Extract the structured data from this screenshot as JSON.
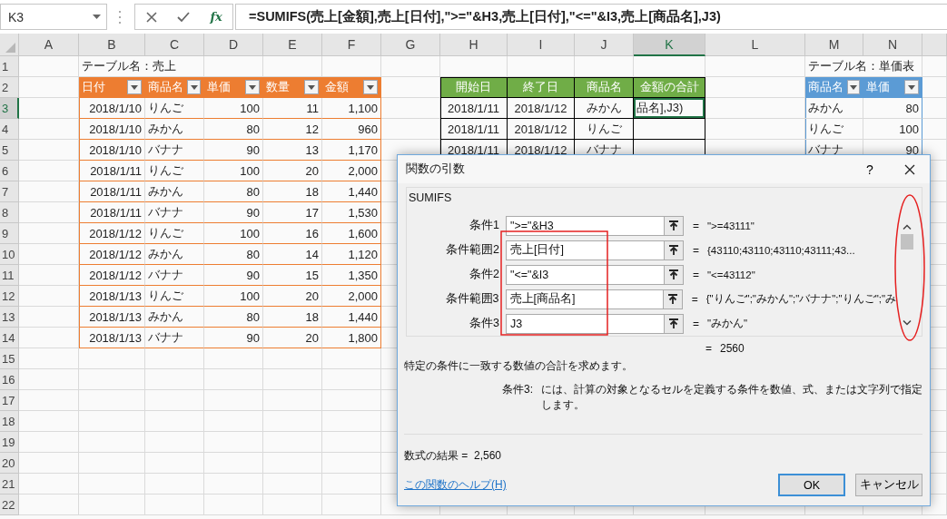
{
  "name_box": {
    "value": "K3"
  },
  "formula_bar": {
    "function_button": "fx",
    "formula": "=SUMIFS(売上[金額],売上[日付],\">=\"&H3,売上[日付],\"<=\"&I3,売上[商品名],J3)"
  },
  "sheet": {
    "columns": [
      {
        "label": "A",
        "selected": false
      },
      {
        "label": "B",
        "selected": false
      },
      {
        "label": "C",
        "selected": false
      },
      {
        "label": "D",
        "selected": false
      },
      {
        "label": "E",
        "selected": false
      },
      {
        "label": "F",
        "selected": false
      },
      {
        "label": "G",
        "selected": false
      },
      {
        "label": "H",
        "selected": false
      },
      {
        "label": "I",
        "selected": false
      },
      {
        "label": "J",
        "selected": false
      },
      {
        "label": "K",
        "selected": true
      },
      {
        "label": "L",
        "selected": false
      },
      {
        "label": "M",
        "selected": false
      },
      {
        "label": "N",
        "selected": false
      }
    ],
    "rows": [
      {
        "label": "1",
        "selected": false
      },
      {
        "label": "2",
        "selected": false
      },
      {
        "label": "3",
        "selected": true
      },
      {
        "label": "4",
        "selected": false
      },
      {
        "label": "5",
        "selected": false
      },
      {
        "label": "6",
        "selected": false
      },
      {
        "label": "7",
        "selected": false
      },
      {
        "label": "8",
        "selected": false
      },
      {
        "label": "9",
        "selected": false
      },
      {
        "label": "10",
        "selected": false
      },
      {
        "label": "11",
        "selected": false
      },
      {
        "label": "12",
        "selected": false
      },
      {
        "label": "13",
        "selected": false
      },
      {
        "label": "14",
        "selected": false
      },
      {
        "label": "15",
        "selected": false
      },
      {
        "label": "16",
        "selected": false
      },
      {
        "label": "17",
        "selected": false
      },
      {
        "label": "18",
        "selected": false
      },
      {
        "label": "19",
        "selected": false
      },
      {
        "label": "20",
        "selected": false
      },
      {
        "label": "21",
        "selected": false
      },
      {
        "label": "22",
        "selected": false
      }
    ]
  },
  "sales_table": {
    "caption": "テーブル名：売上",
    "filter_buttons": true,
    "columns": [
      "日付",
      "商品名",
      "単価",
      "数量",
      "金額"
    ],
    "rows": [
      [
        "2018/1/10",
        "りんご",
        "100",
        "11",
        "1,100"
      ],
      [
        "2018/1/10",
        "みかん",
        "80",
        "12",
        "960"
      ],
      [
        "2018/1/10",
        "バナナ",
        "90",
        "13",
        "1,170"
      ],
      [
        "2018/1/11",
        "りんご",
        "100",
        "20",
        "2,000"
      ],
      [
        "2018/1/11",
        "みかん",
        "80",
        "18",
        "1,440"
      ],
      [
        "2018/1/11",
        "バナナ",
        "90",
        "17",
        "1,530"
      ],
      [
        "2018/1/12",
        "りんご",
        "100",
        "16",
        "1,600"
      ],
      [
        "2018/1/12",
        "みかん",
        "80",
        "14",
        "1,120"
      ],
      [
        "2018/1/12",
        "バナナ",
        "90",
        "15",
        "1,350"
      ],
      [
        "2018/1/13",
        "りんご",
        "100",
        "20",
        "2,000"
      ],
      [
        "2018/1/13",
        "みかん",
        "80",
        "18",
        "1,440"
      ],
      [
        "2018/1/13",
        "バナナ",
        "90",
        "20",
        "1,800"
      ]
    ]
  },
  "criteria_table": {
    "filter_buttons": false,
    "columns": [
      "開始日",
      "終了日",
      "商品名",
      "金額の合計"
    ],
    "rows": [
      [
        "2018/1/11",
        "2018/1/12",
        "みかん",
        "品名],J3)"
      ],
      [
        "2018/1/11",
        "2018/1/12",
        "りんご"
      ],
      [
        "2018/1/11",
        "2018/1/12",
        "バナナ"
      ]
    ]
  },
  "price_table": {
    "caption": "テーブル名：単価表",
    "filter_buttons": true,
    "columns": [
      "商品名",
      "単価"
    ],
    "rows": [
      [
        "みかん",
        "80"
      ],
      [
        "りんご",
        "100"
      ],
      [
        "バナナ",
        "90"
      ]
    ]
  },
  "dialog": {
    "title": "関数の引数",
    "help_button": "?",
    "function_name": "SUMIFS",
    "arguments": [
      {
        "label": "条件1",
        "value": "\">=\"&H3",
        "equals": "=",
        "result": "\">=43111\""
      },
      {
        "label": "条件範囲2",
        "value": "売上[日付]",
        "equals": "=",
        "result": "{43110;43110;43110;43111;43..."
      },
      {
        "label": "条件2",
        "value": "\"<=\"&I3",
        "equals": "=",
        "result": "\"<=43112\""
      },
      {
        "label": "条件範囲3",
        "value": "売上[商品名]",
        "equals": "=",
        "result": "{\"りんご\";\"みかん\";\"バナナ\";\"りんご\";\"み"
      },
      {
        "label": "条件3",
        "value": "J3",
        "equals": "=",
        "result": "\"みかん\""
      }
    ],
    "total": {
      "equals": "=",
      "value": "2560"
    },
    "description": "特定の条件に一致する数値の合計を求めます。",
    "argument_help": {
      "label": "条件3:",
      "text": "には、計算の対象となるセルを定義する条件を数値、式、または文字列で指定します。"
    },
    "formula_result": {
      "label": "数式の結果 =",
      "value": "2,560"
    },
    "help_link": "この関数のヘルプ(H)",
    "buttons": [
      {
        "label": "OK",
        "default": true
      },
      {
        "label": "キャンセル",
        "default": false
      }
    ]
  }
}
